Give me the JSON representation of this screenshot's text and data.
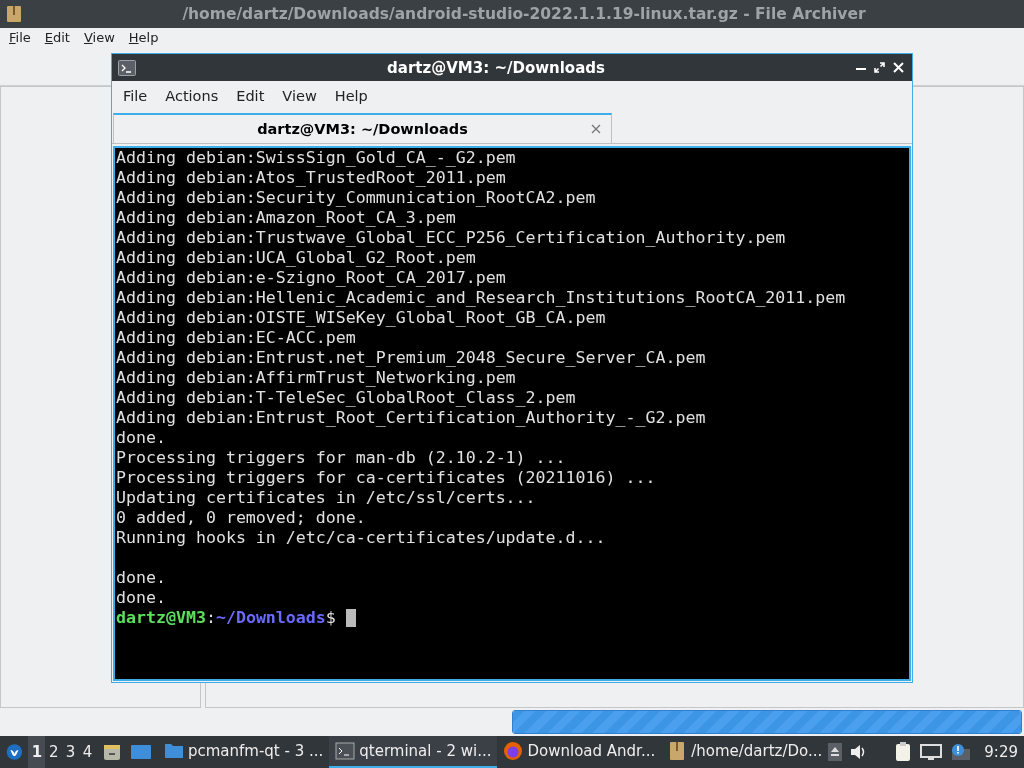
{
  "archiver": {
    "title": "/home/dartz/Downloads/android-studio-2022.1.1.19-linux.tar.gz - File Archiver",
    "menu": [
      {
        "label": "File"
      },
      {
        "label": "Edit"
      },
      {
        "label": "View"
      },
      {
        "label": "Help"
      }
    ],
    "progress": {
      "level": 1
    }
  },
  "terminal": {
    "title": "dartz@VM3: ~/Downloads",
    "menu": [
      "File",
      "Actions",
      "Edit",
      "View",
      "Help"
    ],
    "tabs": [
      {
        "label": "dartz@VM3: ~/Downloads",
        "selected": true
      }
    ],
    "output_blocks": [
      {
        "lines": [
          "Adding debian:SwissSign_Gold_CA_-_G2.pem",
          "Adding debian:Atos_TrustedRoot_2011.pem",
          "Adding debian:Security_Communication_RootCA2.pem",
          "Adding debian:Amazon_Root_CA_3.pem",
          "Adding debian:Trustwave_Global_ECC_P256_Certification_Authority.pem",
          "Adding debian:UCA_Global_G2_Root.pem",
          "Adding debian:e-Szigno_Root_CA_2017.pem",
          "Adding debian:Hellenic_Academic_and_Research_Institutions_RootCA_2011.pem",
          "Adding debian:OISTE_WISeKey_Global_Root_GB_CA.pem",
          "Adding debian:EC-ACC.pem",
          "Adding debian:Entrust.net_Premium_2048_Secure_Server_CA.pem",
          "Adding debian:AffirmTrust_Networking.pem",
          "Adding debian:T-TeleSec_GlobalRoot_Class_2.pem",
          "Adding debian:Entrust_Root_Certification_Authority_-_G2.pem",
          "done.",
          "Processing triggers for man-db (2.10.2-1) ...",
          "Processing triggers for ca-certificates (20211016) ...",
          "Updating certificates in /etc/ssl/certs...",
          "0 added, 0 removed; done.",
          "Running hooks in /etc/ca-certificates/update.d..."
        ]
      },
      {
        "lines": [
          "done.",
          "done."
        ]
      }
    ],
    "prompt": {
      "user": "dartz@VM3",
      "separator": ":",
      "path": "~/Downloads",
      "symbol": "$"
    }
  },
  "taskbar": {
    "desktops": [
      {
        "label": "1",
        "selected": true
      },
      {
        "label": "2",
        "selected": false
      },
      {
        "label": "3",
        "selected": false
      },
      {
        "label": "4",
        "selected": false
      }
    ],
    "tasks": [
      {
        "label": "pcmanfm-qt - 3 ...",
        "kind": "folder",
        "selected": false
      },
      {
        "label": "qterminal - 2 wi...",
        "kind": "terminal",
        "selected": true
      },
      {
        "label": "Download Andr...",
        "kind": "browser",
        "selected": false
      },
      {
        "label": "/home/dartz/Do...",
        "kind": "archive",
        "selected": false
      }
    ],
    "clock": "9:29"
  }
}
